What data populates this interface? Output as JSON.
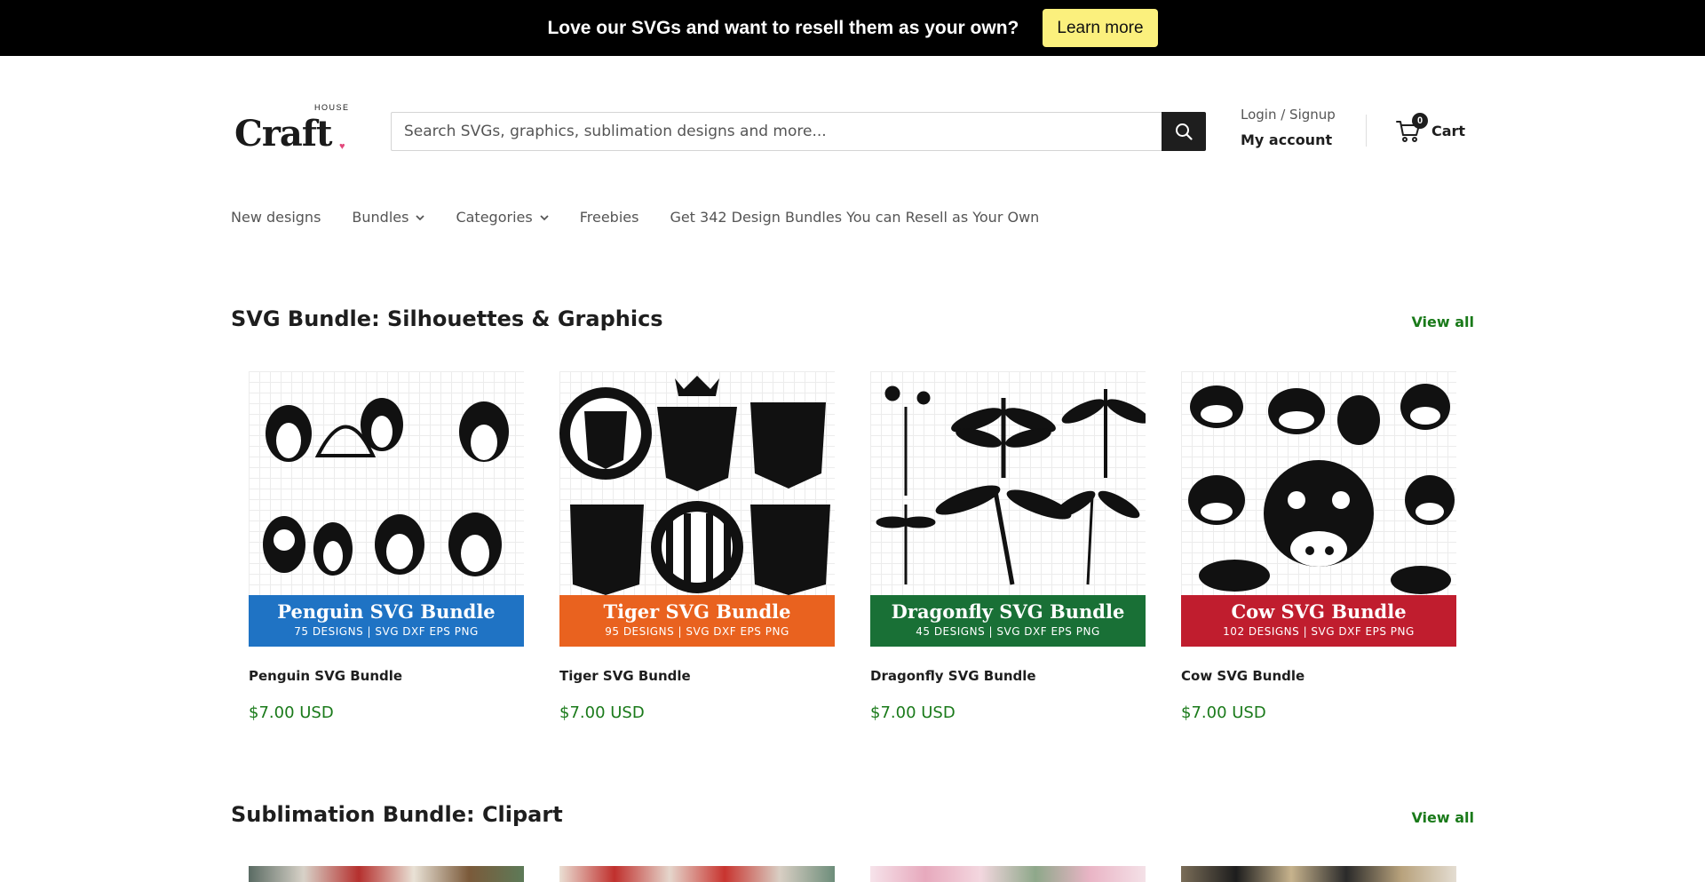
{
  "announcement": {
    "text": "Love our SVGs and want to resell them as your own?",
    "button": "Learn more",
    "button_color": "#fbf07d"
  },
  "logo": {
    "word": "Craft",
    "small": "HOUSE"
  },
  "search": {
    "placeholder": "Search SVGs, graphics, sublimation designs and more...",
    "icon": "search-icon"
  },
  "account": {
    "login": "Login / Signup",
    "my_account": "My account"
  },
  "cart": {
    "count": "0",
    "label": "Cart",
    "icon": "cart-icon"
  },
  "nav": [
    {
      "label": "New designs",
      "dropdown": false
    },
    {
      "label": "Bundles",
      "dropdown": true
    },
    {
      "label": "Categories",
      "dropdown": true
    },
    {
      "label": "Freebies",
      "dropdown": false
    },
    {
      "label": "Get 342 Design Bundles You can Resell as Your Own",
      "dropdown": false
    }
  ],
  "sections": [
    {
      "title": "SVG Bundle: Silhouettes & Graphics",
      "view_all": "View all",
      "products": [
        {
          "title": "Penguin SVG Bundle",
          "price": "$7.00 USD",
          "banner_title": "Penguin SVG Bundle",
          "banner_sub": "75 DESIGNS | SVG DXF EPS PNG",
          "banner_color": "#1f73c4"
        },
        {
          "title": "Tiger SVG Bundle",
          "price": "$7.00 USD",
          "banner_title": "Tiger SVG Bundle",
          "banner_sub": "95 DESIGNS | SVG DXF EPS PNG",
          "banner_color": "#e9621f"
        },
        {
          "title": "Dragonfly SVG Bundle",
          "price": "$7.00 USD",
          "banner_title": "Dragonfly SVG Bundle",
          "banner_sub": "45 DESIGNS | SVG DXF EPS PNG",
          "banner_color": "#197036"
        },
        {
          "title": "Cow SVG Bundle",
          "price": "$7.00 USD",
          "banner_title": "Cow SVG Bundle",
          "banner_sub": "102 DESIGNS | SVG DXF EPS PNG",
          "banner_color": "#c01d2e"
        }
      ]
    },
    {
      "title": "Sublimation Bundle: Clipart",
      "view_all": "View all"
    }
  ],
  "colors": {
    "price": "#1a7a1a",
    "accent": "#1e1e1e"
  }
}
